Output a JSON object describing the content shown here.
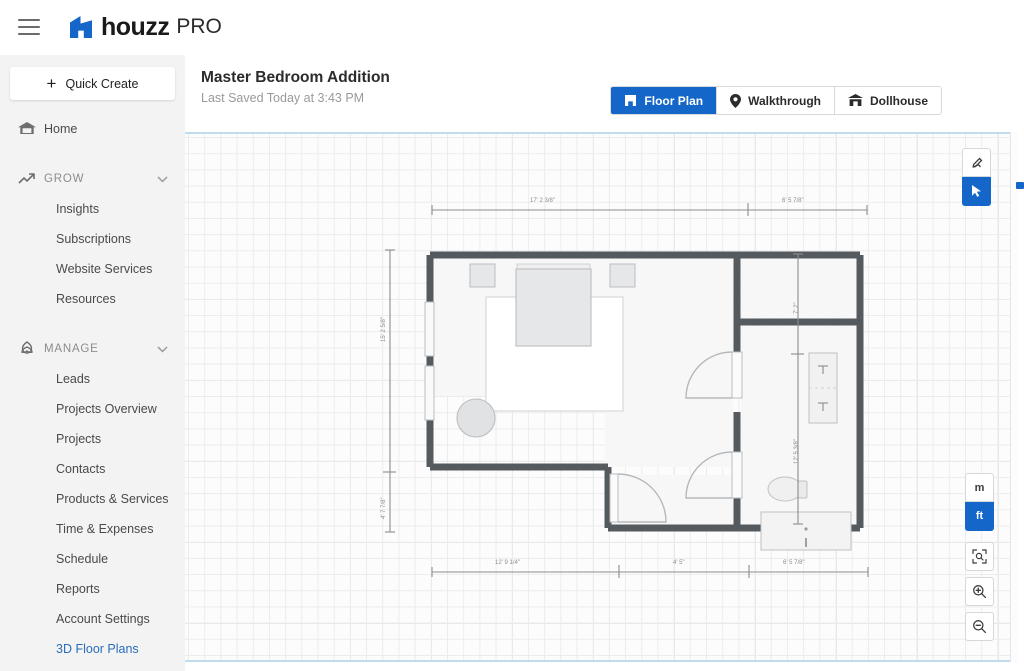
{
  "topbar": {
    "menu_icon": "hamburger-icon",
    "logo_mark": "houzz-h-icon",
    "logo_text": "houzz",
    "logo_suffix": "PRO",
    "brand_color": "#1467c8"
  },
  "sidebar": {
    "quick_create": {
      "label": "Quick Create",
      "icon": "plus-icon"
    },
    "home": {
      "label": "Home",
      "icon": "home-icon"
    },
    "groups": [
      {
        "label": "GROW",
        "icon": "trending-up-icon",
        "chevron": "chevron-down-icon",
        "items": [
          {
            "label": "Insights",
            "active": false
          },
          {
            "label": "Subscriptions",
            "active": false
          },
          {
            "label": "Website Services",
            "active": false
          },
          {
            "label": "Resources",
            "active": false
          }
        ]
      },
      {
        "label": "MANAGE",
        "icon": "leaf-icon",
        "chevron": "chevron-down-icon",
        "items": [
          {
            "label": "Leads",
            "active": false
          },
          {
            "label": "Projects Overview",
            "active": false
          },
          {
            "label": "Projects",
            "active": false
          },
          {
            "label": "Contacts",
            "active": false
          },
          {
            "label": "Products & Services",
            "active": false
          },
          {
            "label": "Time & Expenses",
            "active": false
          },
          {
            "label": "Schedule",
            "active": false
          },
          {
            "label": "Reports",
            "active": false
          },
          {
            "label": "Account Settings",
            "active": false
          },
          {
            "label": "3D Floor Plans",
            "active": true
          }
        ]
      }
    ],
    "active_color": "#2a6ebb"
  },
  "header": {
    "project_title": "Master Bedroom Addition",
    "last_saved": "Last Saved Today at 3:43 PM",
    "tabs": [
      {
        "label": "Floor Plan",
        "icon": "floorplan-icon",
        "active": true
      },
      {
        "label": "Walkthrough",
        "icon": "pin-icon",
        "active": false
      },
      {
        "label": "Dollhouse",
        "icon": "dollhouse-icon",
        "active": false
      }
    ],
    "active_tab_color": "#1467c8"
  },
  "tools": {
    "top_right": [
      {
        "name": "measure-tool",
        "icon": "measure-icon",
        "active": false
      },
      {
        "name": "select-tool",
        "icon": "cursor-arrow-icon",
        "active": true
      }
    ],
    "units": [
      {
        "label": "m",
        "active": false
      },
      {
        "label": "ft",
        "active": true
      }
    ],
    "zoom_controls": [
      {
        "name": "fit-to-screen-button",
        "icon": "fit-screen-icon"
      },
      {
        "name": "zoom-in-button",
        "icon": "magnifier-plus-icon"
      },
      {
        "name": "zoom-out-button",
        "icon": "magnifier-minus-icon"
      }
    ]
  },
  "floorplan": {
    "units": "ft",
    "dimensions": {
      "top": [
        "17' 2 3/8\"",
        "6' 5 7/8\""
      ],
      "bottom": [
        "12' 9 1/4\"",
        "4' 5\"",
        "6' 5 7/8\""
      ],
      "left": [
        "15' 2 5/8\"",
        "4' 7 7/8\""
      ],
      "right": [
        "7' 2\"",
        "12' 5 3/8\""
      ]
    },
    "rooms": [
      {
        "name": "master-bedroom"
      },
      {
        "name": "closet"
      },
      {
        "name": "bathroom"
      },
      {
        "name": "entry-vestibule"
      }
    ],
    "furniture": [
      {
        "name": "bed"
      },
      {
        "name": "nightstand-left"
      },
      {
        "name": "nightstand-right"
      },
      {
        "name": "area-rug"
      },
      {
        "name": "round-side-table"
      },
      {
        "name": "double-vanity"
      },
      {
        "name": "toilet"
      },
      {
        "name": "shower-tub"
      }
    ],
    "wall_color": "#555a5e",
    "fill_color": "#f7f7f7",
    "dim_line_color": "#8d8d8d"
  }
}
